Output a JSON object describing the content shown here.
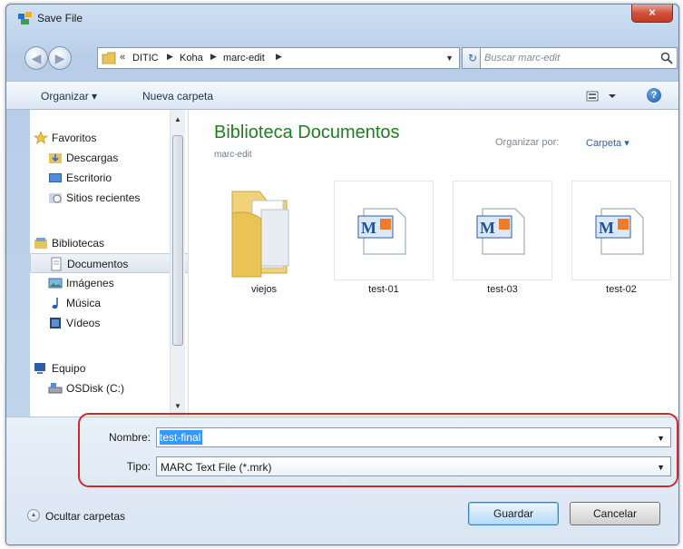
{
  "window": {
    "title": "Save File",
    "close_label": "×"
  },
  "address": {
    "prefix": "«",
    "breadcrumbs": [
      "DITIC",
      "Koha",
      "marc-edit"
    ],
    "search_placeholder": "Buscar marc-edit"
  },
  "toolbar": {
    "organize": "Organizar ▾",
    "new_folder": "Nueva carpeta",
    "help": "?"
  },
  "navigation": {
    "favorites": {
      "label": "Favoritos",
      "items": [
        "Descargas",
        "Escritorio",
        "Sitios recientes"
      ]
    },
    "libraries": {
      "label": "Bibliotecas",
      "items": [
        "Documentos",
        "Imágenes",
        "Música",
        "Vídeos"
      ],
      "selected": "Documentos"
    },
    "computer": {
      "label": "Equipo",
      "items": [
        "OSDisk (C:)"
      ]
    }
  },
  "content": {
    "library_title": "Biblioteca Documentos",
    "library_subtitle": "marc-edit",
    "arrange_label": "Organizar por:",
    "arrange_value": "Carpeta ▾",
    "files": [
      {
        "name": "viejos",
        "kind": "folder"
      },
      {
        "name": "test-01",
        "kind": "marc-file"
      },
      {
        "name": "test-03",
        "kind": "marc-file"
      },
      {
        "name": "test-02",
        "kind": "marc-file"
      }
    ]
  },
  "form": {
    "name_label": "Nombre:",
    "name_value": "test-final",
    "type_label": "Tipo:",
    "type_value": "MARC Text File (*.mrk)"
  },
  "footer": {
    "hide_folders": "Ocultar carpetas",
    "save": "Guardar",
    "cancel": "Cancelar"
  },
  "colors": {
    "highlight": "#cf2a2a",
    "library_title": "#1d7f1d",
    "selection": "#3399ff"
  }
}
